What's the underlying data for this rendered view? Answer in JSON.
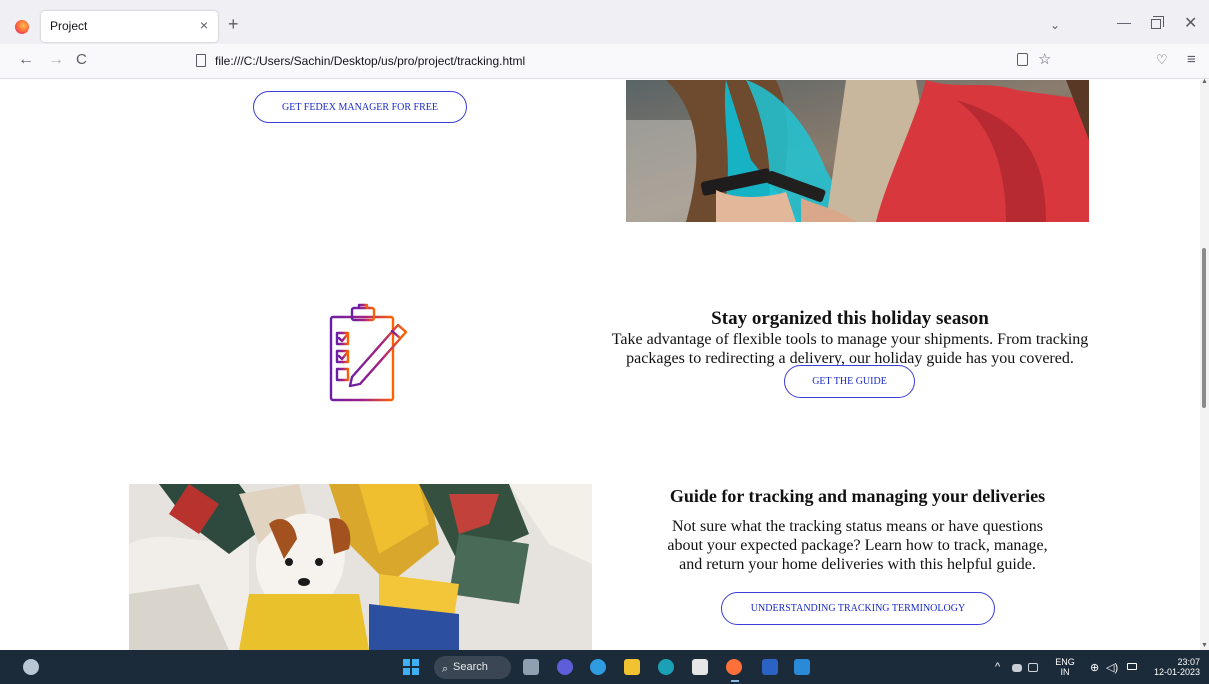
{
  "browser": {
    "tab_title": "Project",
    "tab_close": "×",
    "new_tab": "+",
    "tab_list": "⌄",
    "url": "file:///C:/Users/Sachin/Desktop/us/pro/project/tracking.html",
    "back": "←",
    "forward": "→",
    "reload": "C",
    "window_minimize": "—",
    "window_close": "✕",
    "menu": "≡"
  },
  "page": {
    "manager_button": "GET FEDEX MANAGER FOR FREE",
    "holiday": {
      "heading": "Stay organized this holiday season",
      "body_line1": "Take advantage of flexible tools to manage your shipments. From tracking",
      "body_line2": "packages to redirecting a delivery, our holiday guide has you covered.",
      "button": "GET THE GUIDE"
    },
    "guide": {
      "heading": "Guide for tracking and managing your deliveries",
      "body_line1": "Not sure what the tracking status means or have questions",
      "body_line2": "about your expected package? Learn how to track, manage,",
      "body_line3": "and return your home deliveries with this helpful guide.",
      "button": "UNDERSTANDING TRACKING TERMINOLOGY"
    },
    "icon_gradient": [
      "#4d148c",
      "#ff6200"
    ]
  },
  "taskbar": {
    "search_label": "Search",
    "lang_line1": "ENG",
    "lang_line2": "IN",
    "time": "23:07",
    "date": "12-01-2023"
  }
}
